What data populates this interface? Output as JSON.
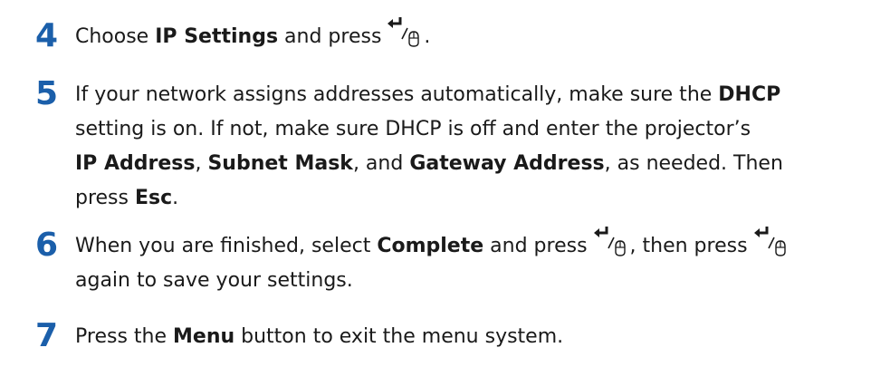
{
  "steps": [
    {
      "number": "4",
      "lines": [
        [
          {
            "t": "Choose "
          },
          {
            "t": "IP Settings",
            "b": true
          },
          {
            "t": " and press "
          },
          {
            "icon": "enter-mouse-icon"
          },
          {
            "t": "."
          }
        ]
      ]
    },
    {
      "number": "5",
      "lines": [
        [
          {
            "t": "If your network assigns addresses automatically, make sure the "
          },
          {
            "t": "DHCP",
            "b": true
          }
        ],
        [
          {
            "t": "setting is on. If not, make sure DHCP is off and enter the projector’s"
          }
        ],
        [
          {
            "t": "IP Address",
            "b": true
          },
          {
            "t": ", "
          },
          {
            "t": "Subnet Mask",
            "b": true
          },
          {
            "t": ", and "
          },
          {
            "t": "Gateway Address",
            "b": true
          },
          {
            "t": ", as needed. Then"
          }
        ],
        [
          {
            "t": "press "
          },
          {
            "t": "Esc",
            "b": true
          },
          {
            "t": "."
          }
        ]
      ]
    },
    {
      "number": "6",
      "lines": [
        [
          {
            "t": "When you are finished, select "
          },
          {
            "t": "Complete",
            "b": true
          },
          {
            "t": " and press "
          },
          {
            "icon": "enter-mouse-icon"
          },
          {
            "t": ", then press "
          },
          {
            "icon": "enter-mouse-icon"
          }
        ],
        [
          {
            "t": "again to save your settings."
          }
        ]
      ]
    },
    {
      "number": "7",
      "lines": [
        [
          {
            "t": "Press the "
          },
          {
            "t": "Menu",
            "b": true
          },
          {
            "t": " button to exit the menu system."
          }
        ]
      ]
    }
  ],
  "colors": {
    "step_number": "#1b5faa",
    "text": "#1a1a1a",
    "background": "#ffffff"
  }
}
